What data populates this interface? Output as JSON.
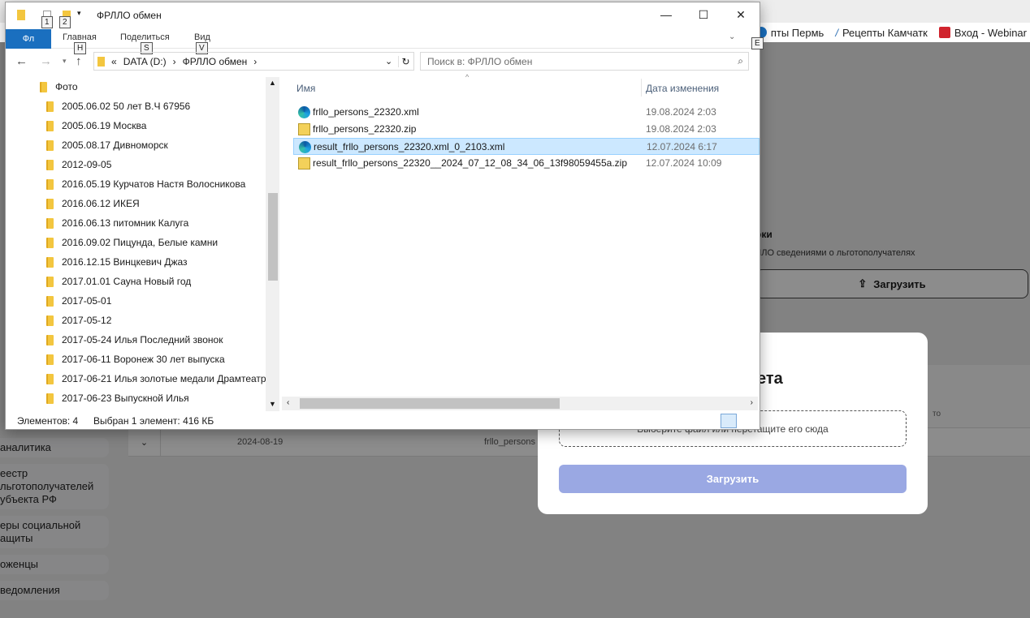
{
  "background": {
    "bookmarks": [
      {
        "label": "пты Пермь",
        "icon": "help-icon",
        "color": "#1a6fbf"
      },
      {
        "label": "Рецепты Камчатк",
        "icon": "quill-icon",
        "color": "#2d6fb3"
      },
      {
        "label": "Вход - Webinar",
        "icon": "webinar-icon",
        "color": "#d0232d"
      }
    ],
    "sidebar_items": [
      {
        "label": "аналитика"
      },
      {
        "label": "еестр\nльготополучателей\nубъекта РФ"
      },
      {
        "label": "еры социальной\nащиты"
      },
      {
        "label": "оженцы"
      },
      {
        "label": "ведомления"
      }
    ],
    "upload_card": {
      "title": "рки",
      "description": "ЛЛО сведениями о льготополучателях",
      "button_label": "Загрузить"
    },
    "table": {
      "header_hint": "то",
      "row": {
        "date": "2024-08-19",
        "file": "frllo_persons"
      }
    },
    "modal": {
      "title_fragment": "ета",
      "dropzone_text": "Выберите файл или перетащите его сюда",
      "submit_label": "Загрузить",
      "submit_color": "#9aa8e3"
    }
  },
  "explorer": {
    "title": "ФРЛЛО обмен",
    "keytips": {
      "qa1": "1",
      "qa2": "2",
      "home": "H",
      "share": "S",
      "view": "V",
      "help": "E"
    },
    "ribbon": {
      "file_tab": "Фл",
      "tabs": [
        "Главная",
        "Поделиться",
        "Вид"
      ]
    },
    "address": {
      "prefix": "«",
      "parts": [
        "DATA (D:)",
        "ФРЛЛО обмен"
      ]
    },
    "search_placeholder": "Поиск в: ФРЛЛО обмен",
    "tree": [
      "Фото",
      "2005.06.02 50 лет В.Ч 67956",
      "2005.06.19 Москва",
      "2005.08.17 Дивноморск",
      "2012-09-05",
      "2016.05.19 Курчатов Настя Волосникова",
      "2016.06.12 ИКЕЯ",
      "2016.06.13 питомник Калуга",
      "2016.09.02 Пицунда, Белые камни",
      "2016.12.15 Винцкевич Джаз",
      "2017.01.01 Сауна Новый год",
      "2017-05-01",
      "2017-05-12",
      "2017-05-24 Илья Последний звонок",
      "2017-06-11 Воронеж 30 лет выпуска",
      "2017-06-21 Илья золотые медали Драмтеатр",
      "2017-06-23 Выпускной Илья"
    ],
    "columns": {
      "name": "Имя",
      "date": "Дата изменения"
    },
    "files": [
      {
        "name": "frllo_persons_22320.xml",
        "date": "19.08.2024 2:03",
        "icon": "edge-icon",
        "selected": false
      },
      {
        "name": "frllo_persons_22320.zip",
        "date": "19.08.2024 2:03",
        "icon": "zip-icon",
        "selected": false
      },
      {
        "name": "result_frllo_persons_22320.xml_0_2103.xml",
        "date": "12.07.2024 6:17",
        "icon": "edge-icon",
        "selected": true
      },
      {
        "name": "result_frllo_persons_22320__2024_07_12_08_34_06_13f98059455a.zip",
        "date": "12.07.2024 10:09",
        "icon": "zip-icon",
        "selected": false
      }
    ],
    "status": {
      "items": "Элементов: 4",
      "selected": "Выбран 1 элемент: 416 КБ"
    }
  }
}
